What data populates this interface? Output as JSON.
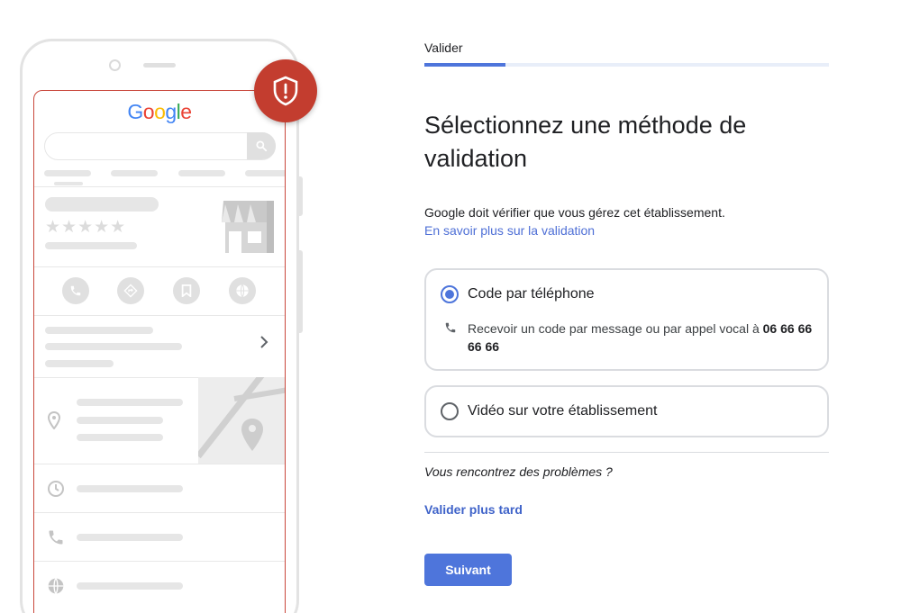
{
  "phone_preview": {
    "logo_text": "Google",
    "stars": "★★★★★"
  },
  "step": {
    "label": "Valider",
    "progress": 0.2
  },
  "main": {
    "title": "Sélectionnez une méthode de validation",
    "description": "Google doit vérifier que vous gérez cet établissement.",
    "learn_more_link": "En savoir plus sur la validation"
  },
  "options": [
    {
      "title": "Code par téléphone",
      "selected": true,
      "detail_prefix": "Recevoir un code par message ou par appel vocal à ",
      "phone_number": "06 66 66 66 66"
    },
    {
      "title": "Vidéo sur votre établissement",
      "selected": false
    }
  ],
  "footer": {
    "trouble_text": "Vous rencontrez des problèmes ?",
    "later_link": "Valider plus tard",
    "next_button": "Suivant"
  },
  "colors": {
    "accent": "#4e75db",
    "badge_red": "#c33d2f",
    "link": "#4e6fd6"
  },
  "icons": [
    "search-icon",
    "shop-icon",
    "call-icon",
    "directions-icon",
    "bookmark-icon",
    "website-icon",
    "chevron-right-icon",
    "pin-icon",
    "clock-icon",
    "phone-icon",
    "globe-icon",
    "shield-alert-icon"
  ]
}
